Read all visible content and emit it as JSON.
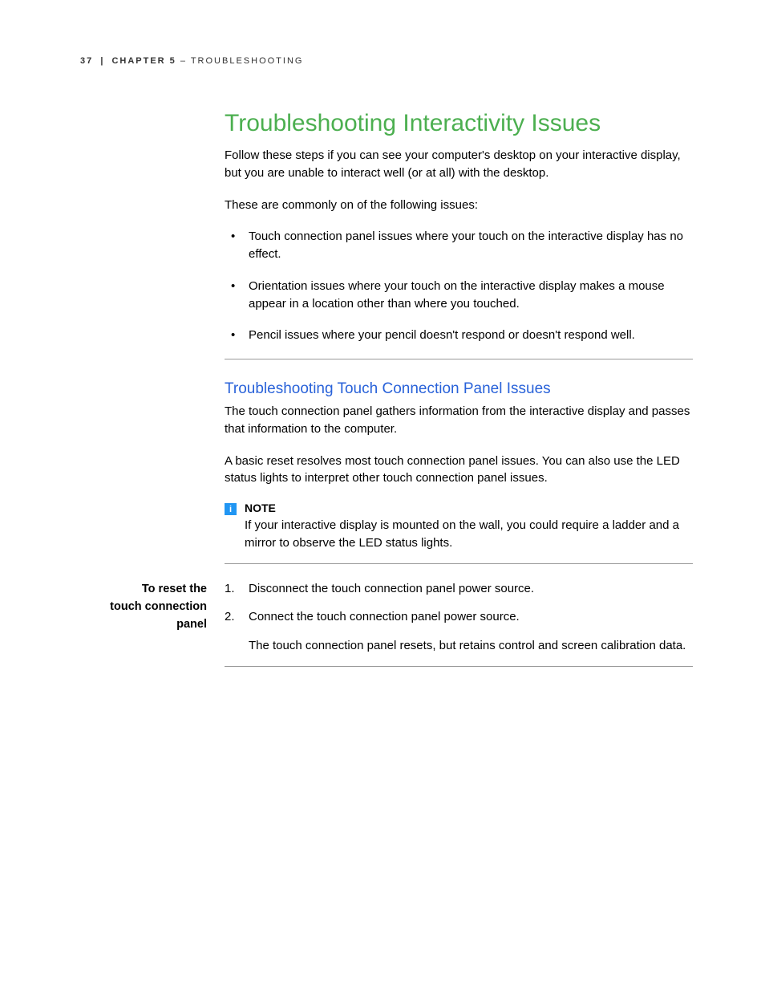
{
  "header": {
    "page_num": "37",
    "chapter_label": "CHAPTER 5",
    "separator": " – ",
    "chapter_title": "TROUBLESHOOTING"
  },
  "h1": "Troubleshooting Interactivity Issues",
  "intro1": "Follow these steps if you can see your computer's desktop on your interactive display, but you are unable to interact well (or at all) with the desktop.",
  "intro2": "These are commonly on of the following issues:",
  "bullets": [
    "Touch connection panel issues where your touch on the interactive display has no effect.",
    "Orientation issues where your touch on the interactive display makes a mouse appear in a location other than where you touched.",
    "Pencil issues where your pencil doesn't respond or doesn't respond well."
  ],
  "h2": "Troubleshooting Touch Connection Panel Issues",
  "sub_intro1": "The touch connection panel gathers information from the interactive display and passes that information to the computer.",
  "sub_intro2": "A basic reset resolves most touch connection panel issues. You can also use the LED status lights to interpret other touch connection panel issues.",
  "note": {
    "icon_glyph": "i",
    "label": "NOTE",
    "text": "If your interactive display is mounted on the wall, you could require a ladder and a mirror to observe the LED status lights."
  },
  "procedure": {
    "label_line1": "To reset the",
    "label_line2": "touch connection panel",
    "steps": [
      {
        "text": "Disconnect the touch connection panel power source."
      },
      {
        "text": "Connect the touch connection panel power source.",
        "sub": "The touch connection panel resets, but retains control and screen calibration data."
      }
    ]
  }
}
